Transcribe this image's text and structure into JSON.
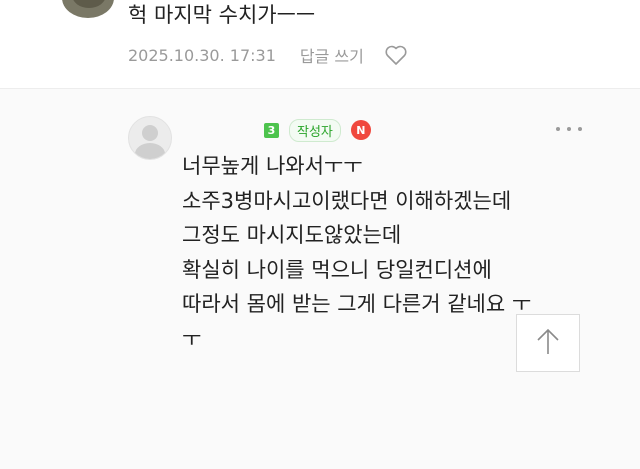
{
  "top_comment": {
    "text": "헉 마지막 수치가ㅡㅡ",
    "date": "2025.10.30. 17:31",
    "reply_label": "답글 쓰기"
  },
  "reply": {
    "author_level": "3",
    "writer_badge": "작성자",
    "n_badge": "N",
    "lines": [
      "너무높게 나와서ㅜㅜ",
      "소주3병마시고이랬다면 이해하겠는데",
      "그정도 마시지도않았는데",
      "확실히 나이를 먹으니 당일컨디션에",
      "따라서 몸에 받는 그게 다른거 같네요 ㅜ",
      "ㅜ"
    ]
  },
  "colors": {
    "meta_gray": "#9a9a9a",
    "level_green": "#4dc34d",
    "writer_green": "#2aa52a",
    "n_red": "#f0483e",
    "redaction_red": "#e8262c"
  },
  "icons": [
    "heart-icon",
    "more-icon",
    "arrow-up-icon",
    "default-avatar-icon"
  ]
}
